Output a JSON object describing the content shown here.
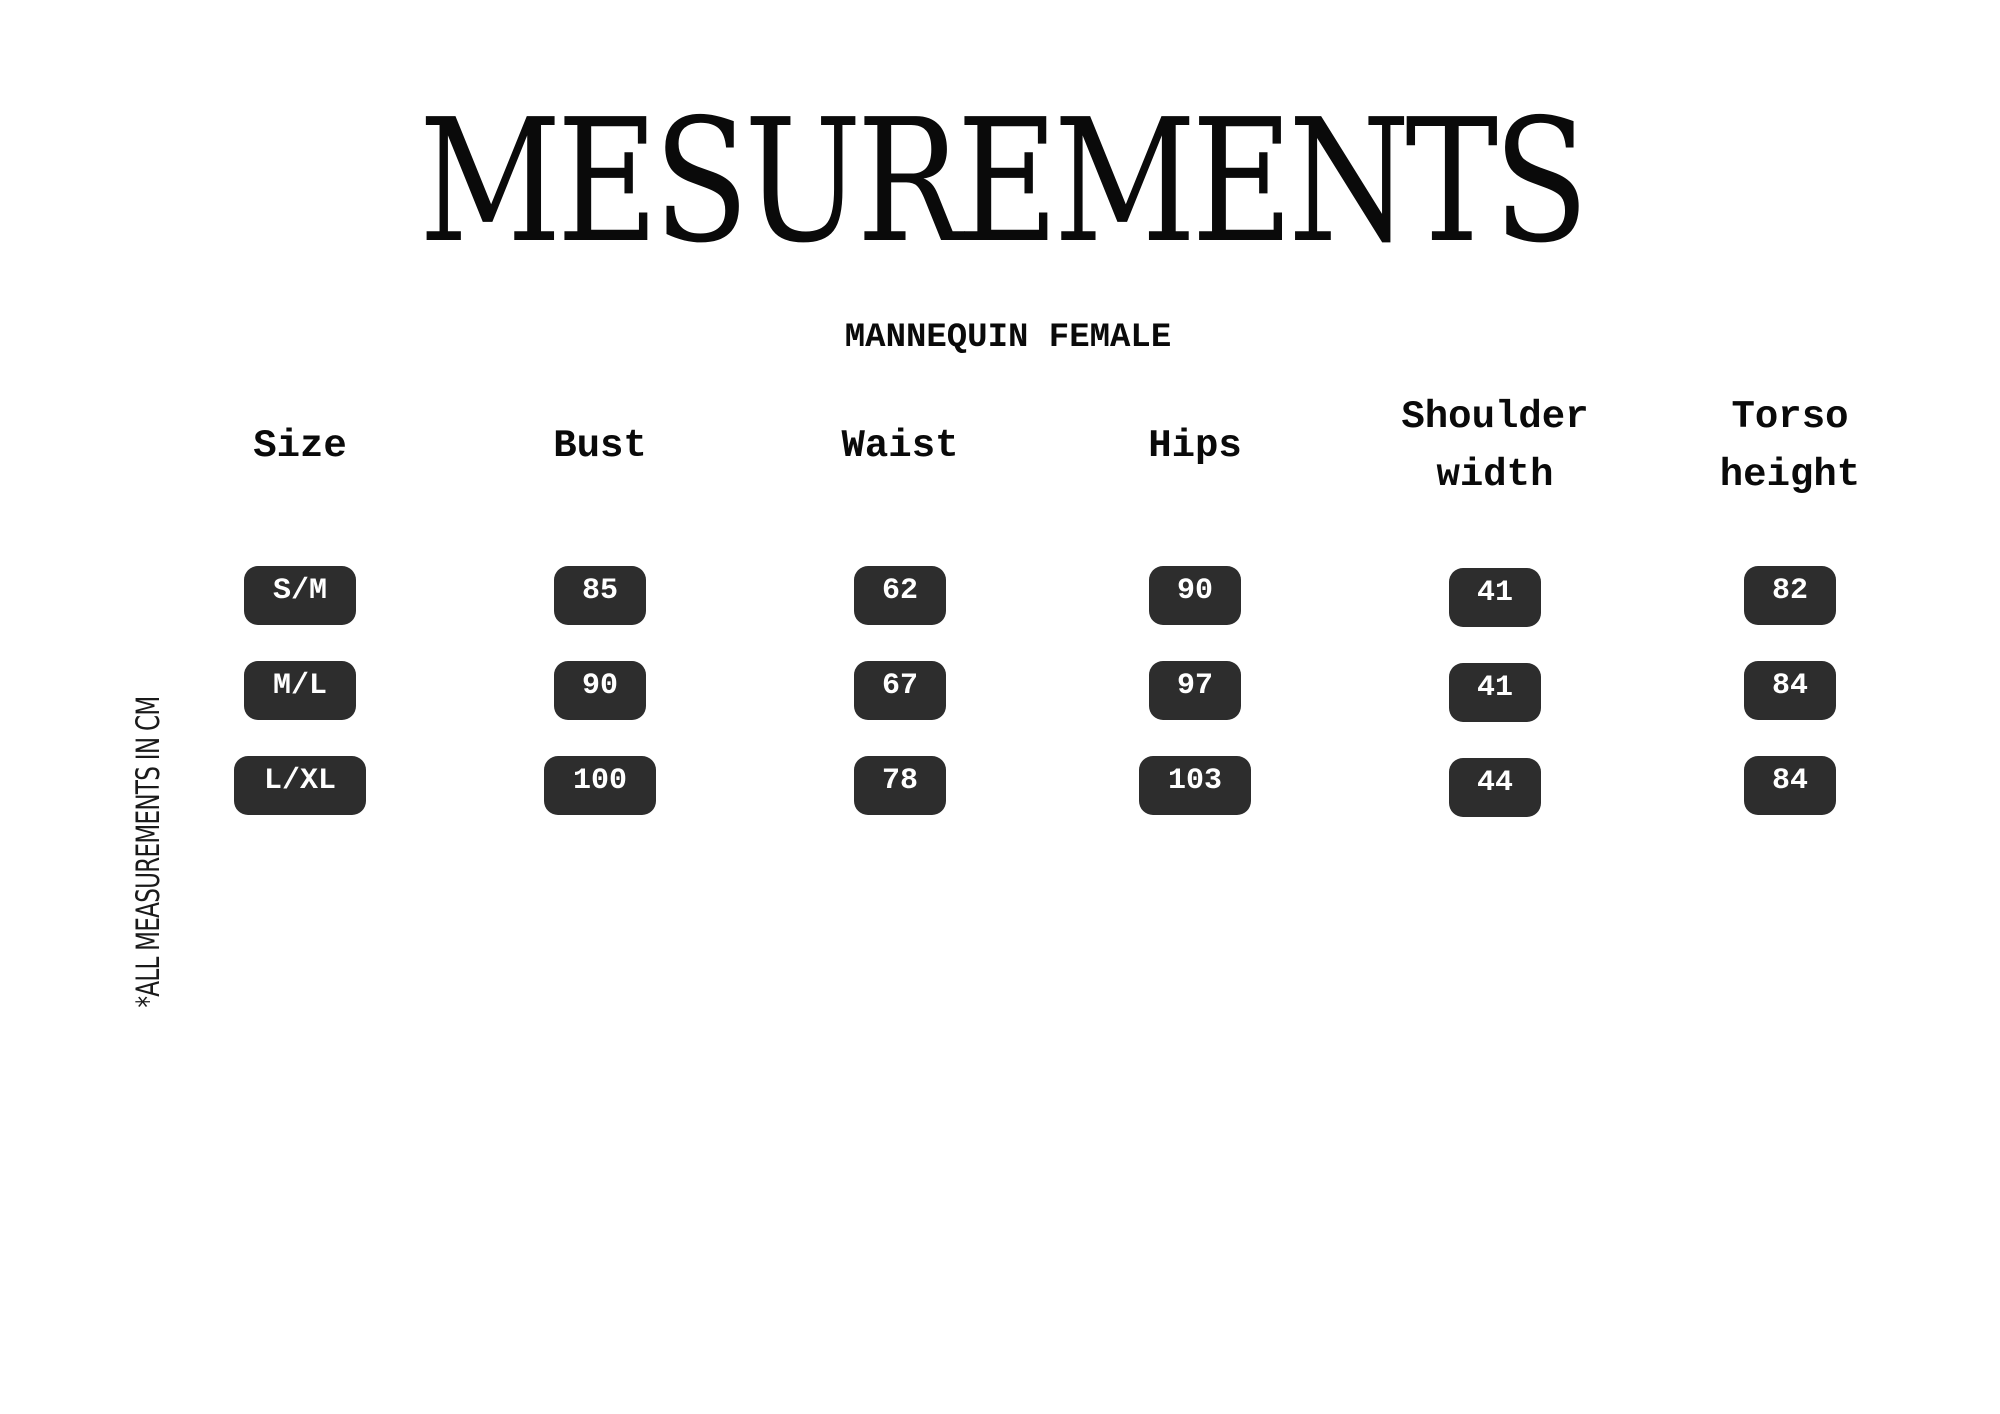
{
  "title": "MESUREMENTS",
  "subtitle": "MANNEQUIN FEMALE",
  "side_note": "*ALL MEASUREMENTS IN CM",
  "table": {
    "columns": [
      {
        "header": "Size",
        "values": [
          "S/M",
          "M/L",
          "L/XL"
        ]
      },
      {
        "header": "Bust",
        "values": [
          "85",
          "90",
          "100"
        ]
      },
      {
        "header": "Waist",
        "values": [
          "62",
          "67",
          "78"
        ]
      },
      {
        "header": "Hips",
        "values": [
          "90",
          "97",
          "103"
        ]
      },
      {
        "header": "Shoulder\nwidth",
        "values": [
          "41",
          "41",
          "44"
        ]
      },
      {
        "header": "Torso\nheight",
        "values": [
          "82",
          "84",
          "84"
        ]
      }
    ]
  },
  "colors": {
    "pill_background": "#2d2d2d",
    "pill_text": "#ffffff",
    "text": "#0a0a0a"
  }
}
